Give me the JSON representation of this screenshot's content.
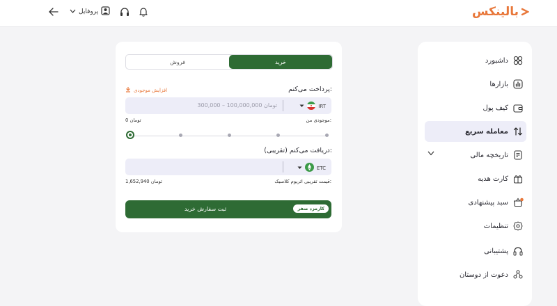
{
  "header": {
    "logo_text": "بالینکس",
    "profile_label": "پروفایل",
    "icons": [
      "back-arrow-icon",
      "chevron-down-icon",
      "user-icon",
      "headset-icon",
      "bell-icon"
    ]
  },
  "sidebar": {
    "items": [
      {
        "label": "داشبورد",
        "icon": "dashboard-icon"
      },
      {
        "label": "بازارها",
        "icon": "markets-icon"
      },
      {
        "label": "کیف پول",
        "icon": "wallet-icon"
      },
      {
        "label": "معامله سریع",
        "icon": "swap-icon",
        "active": true
      },
      {
        "label": "تاریخچه مالی",
        "icon": "history-icon"
      },
      {
        "label": "کارت هدیه",
        "icon": "gift-icon"
      },
      {
        "label": "سبد پیشنهادی",
        "icon": "basket-icon"
      },
      {
        "label": "تنظیمات",
        "icon": "gear-icon"
      },
      {
        "label": "پشتیبانی",
        "icon": "headset-icon"
      },
      {
        "label": "دعوت از دوستان",
        "icon": "invite-icon"
      }
    ]
  },
  "trade": {
    "tab_buy": "خرید",
    "tab_sell": "فروش",
    "active_tab": "buy",
    "pay_label": "پرداخت می‌کنم:",
    "increase_balance": "افزایش موجودی",
    "pay_currency": "IRT",
    "pay_placeholder": "300,000 – 100,000,000 تومان",
    "balance_label": "موجودی من:",
    "balance_value": "0 تومان",
    "slider_value": 0,
    "receive_label": "دریافت می‌کنم (تقریبی):",
    "receive_currency": "ETC",
    "price_label": "قیمت تقریبی اتریوم کلاسیک:",
    "price_value": "1,652,940 تومان",
    "submit_label": "ثبت سفارش خرید",
    "fee_badge": "کارمزد صفر"
  },
  "colors": {
    "accent_green": "#2e6b34",
    "brand_orange": "#e8773a",
    "field_bg": "#ededf8"
  }
}
